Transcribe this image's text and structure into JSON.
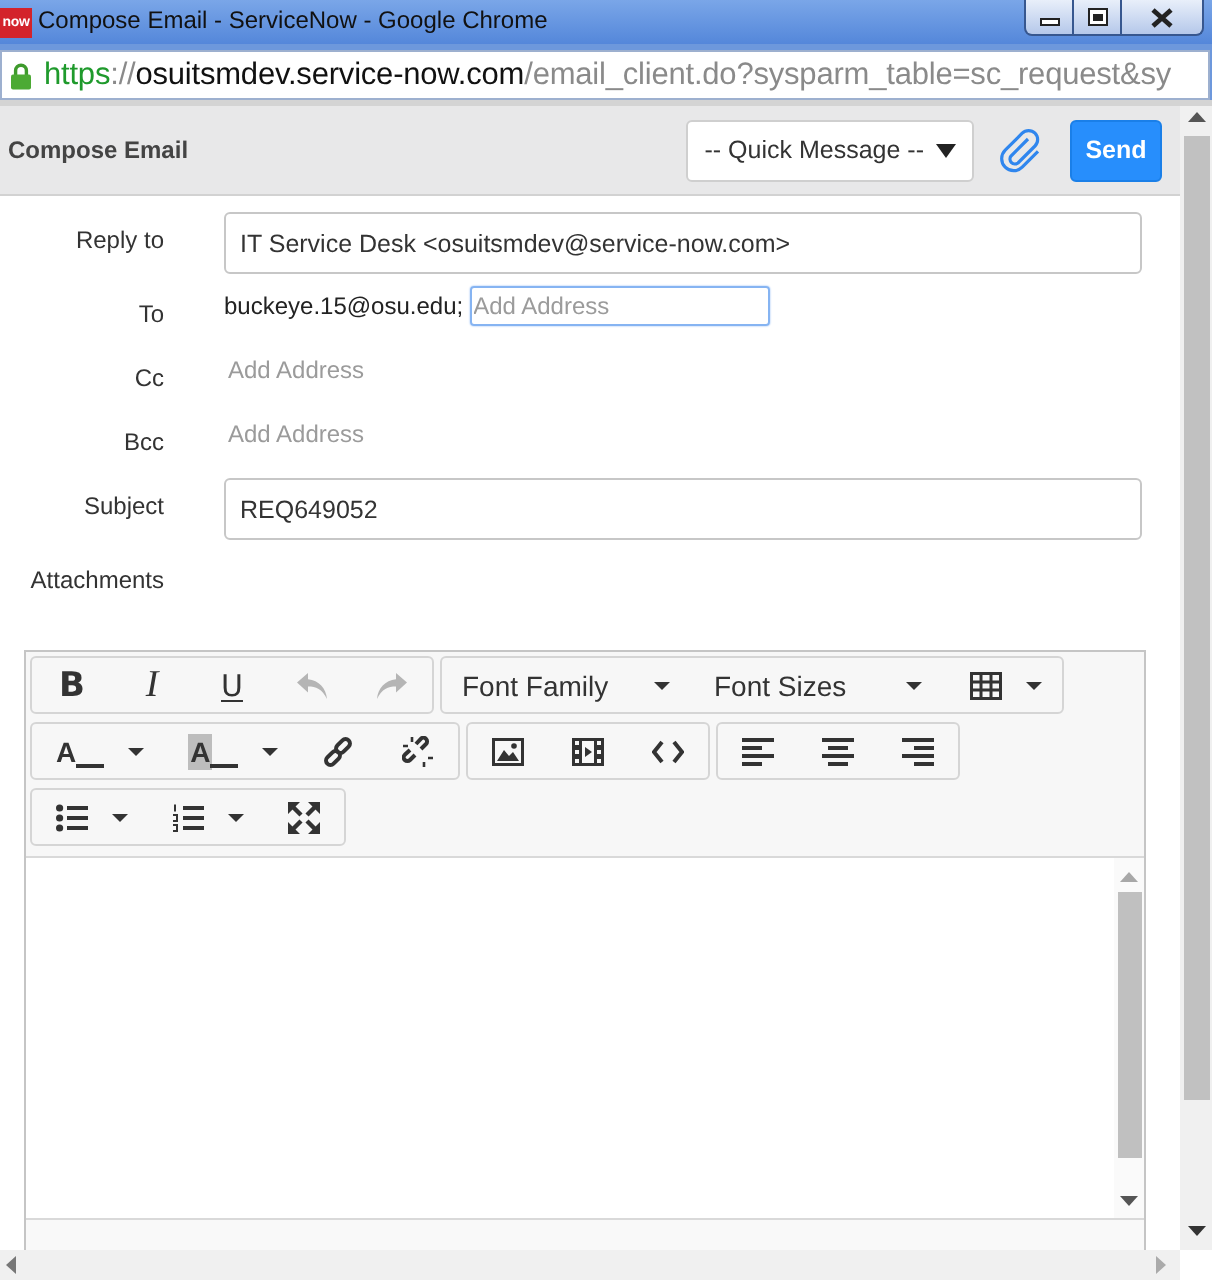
{
  "window": {
    "app_logo": "now",
    "title": "Compose Email - ServiceNow - Google Chrome"
  },
  "address_bar": {
    "secure": true,
    "url": {
      "scheme": "https",
      "separator": "://",
      "host": "osuitsmdev.service-now.com",
      "path": "/email_client.do?sysparm_table=sc_request&sy"
    }
  },
  "header": {
    "title": "Compose Email",
    "quick_message": "-- Quick Message --",
    "send_button": "Send"
  },
  "fields": [
    {
      "kind": "text",
      "label": "Reply to",
      "value": "IT Service Desk <osuitsmdev@service-now.com>"
    },
    {
      "kind": "recipients",
      "label": "To",
      "recipients": [
        "buckeye.15@osu.edu;"
      ],
      "placeholder": "Add Address",
      "focused": true
    },
    {
      "kind": "recipients",
      "label": "Cc",
      "placeholder": "Add Address",
      "focused": false
    },
    {
      "kind": "recipients",
      "label": "Bcc",
      "placeholder": "Add Address",
      "focused": false
    },
    {
      "kind": "text",
      "label": "Subject",
      "value": "REQ649052"
    },
    {
      "kind": "attachments",
      "label": "Attachments"
    }
  ],
  "editor": {
    "toolbar": [
      {
        "groups": [
          {
            "buttons": [
              {
                "kind": "bold",
                "glyph": "B",
                "menu": false,
                "disabled": false
              },
              {
                "kind": "italic",
                "glyph": "I",
                "menu": false,
                "disabled": false
              },
              {
                "kind": "underline",
                "glyph": "U",
                "menu": false,
                "disabled": false
              },
              {
                "kind": "undo",
                "menu": false,
                "disabled": true
              },
              {
                "kind": "redo",
                "menu": false,
                "disabled": true
              }
            ]
          },
          {
            "buttons": [
              {
                "kind": "select",
                "label": "Font Family",
                "menu": true,
                "disabled": false
              },
              {
                "kind": "select",
                "label": "Font Sizes",
                "menu": true,
                "disabled": false
              },
              {
                "kind": "table",
                "menu": true,
                "disabled": false
              }
            ]
          }
        ]
      },
      {
        "groups": [
          {
            "buttons": [
              {
                "kind": "text_color",
                "glyph": "A",
                "menu": true,
                "disabled": false
              },
              {
                "kind": "background_color",
                "glyph": "A",
                "menu": true,
                "disabled": false
              },
              {
                "kind": "link",
                "menu": false,
                "disabled": false
              },
              {
                "kind": "unlink",
                "menu": false,
                "disabled": false
              }
            ]
          },
          {
            "buttons": [
              {
                "kind": "image",
                "menu": false,
                "disabled": false
              },
              {
                "kind": "media",
                "menu": false,
                "disabled": false
              },
              {
                "kind": "code",
                "menu": false,
                "disabled": false
              }
            ]
          },
          {
            "buttons": [
              {
                "kind": "align_left",
                "menu": false,
                "disabled": false
              },
              {
                "kind": "align_center",
                "menu": false,
                "disabled": false
              },
              {
                "kind": "align_right",
                "menu": false,
                "disabled": false
              }
            ]
          }
        ]
      },
      {
        "groups": [
          {
            "buttons": [
              {
                "kind": "bullet_list",
                "menu": true,
                "disabled": false
              },
              {
                "kind": "numbered_list",
                "menu": true,
                "disabled": false
              },
              {
                "kind": "fullscreen",
                "menu": false,
                "disabled": false
              }
            ]
          }
        ]
      }
    ]
  }
}
